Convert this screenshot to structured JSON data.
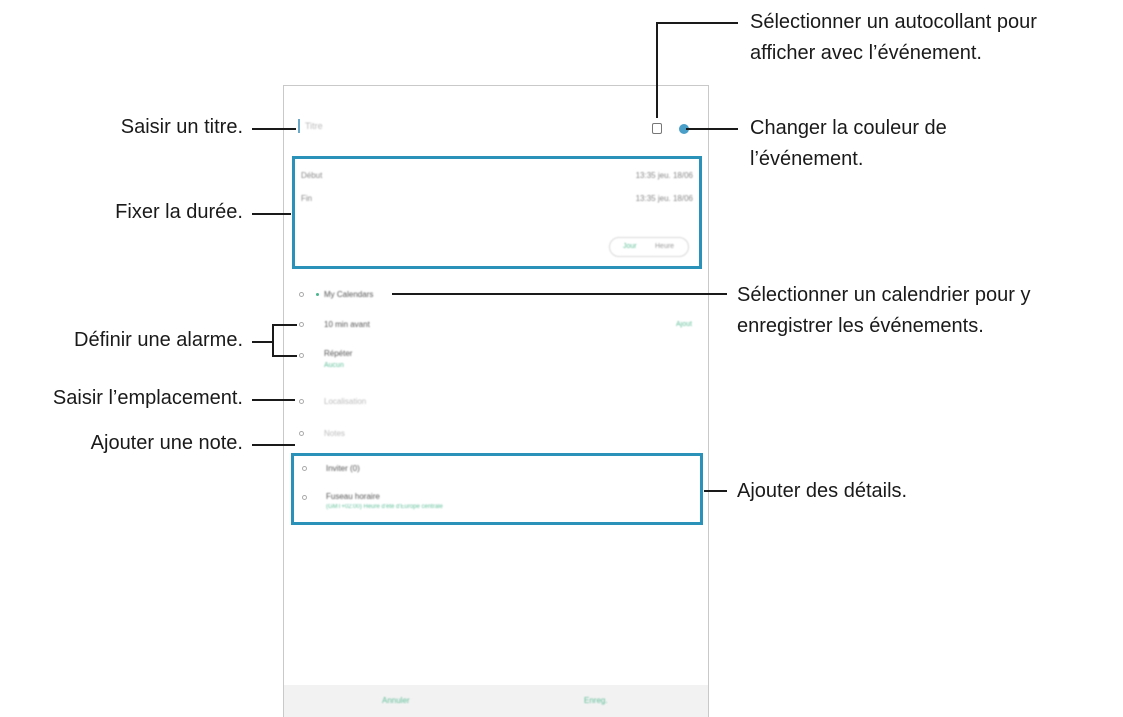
{
  "callouts": {
    "title": "Saisir un titre.",
    "duration": "Fixer la durée.",
    "alarm": "Définir une alarme.",
    "location": "Saisir l’emplacement.",
    "note": "Ajouter une note.",
    "sticker_line1": "Sélectionner un autocollant pour",
    "sticker_line2": "afficher avec l’événement.",
    "color_line1": "Changer la couleur de",
    "color_line2": "l’événement.",
    "calendar_line1": "Sélectionner un calendrier pour y",
    "calendar_line2": "enregistrer les événements.",
    "details": "Ajouter des détails."
  },
  "screen": {
    "title_placeholder": "Titre",
    "start_label": "Début",
    "start_value": "13:35 jeu. 18/06",
    "end_label": "Fin",
    "end_value": "13:35 jeu. 18/06",
    "toggle_left": "Jour",
    "toggle_right": "Heure",
    "calendar": "My Calendars",
    "alarm_before": "10 min avant",
    "alarm_tag": "Ajout",
    "repeat": "Répéter",
    "repeat_value": "Aucun",
    "location": "Localisation",
    "notes": "Notes",
    "invite": "Inviter (0)",
    "timezone": "Fuseau horaire",
    "timezone_value": "(GMT+02:00) Heure d'été d'Europe centrale",
    "cancel": "Annuler",
    "save": "Enreg."
  },
  "colors": {
    "callout_box": "#2a92b9",
    "event_color": "#4a9fc8",
    "accent": "#5fbf9a"
  }
}
